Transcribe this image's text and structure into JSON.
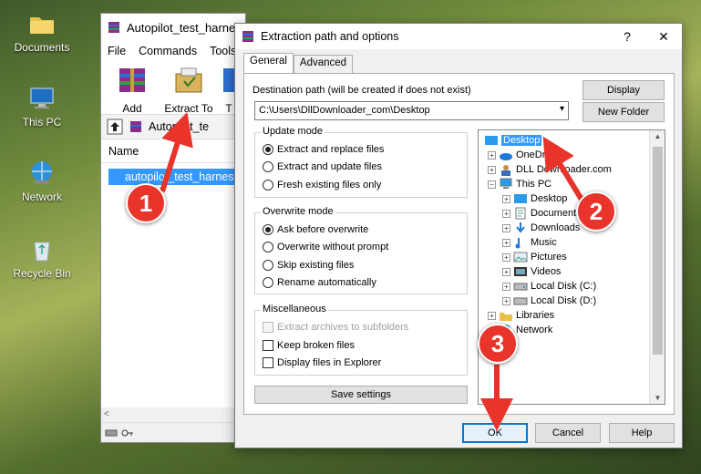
{
  "desktop": {
    "icons": [
      {
        "label": "Documents",
        "icon": "folder-icon"
      },
      {
        "label": "This PC",
        "icon": "computer-icon"
      },
      {
        "label": "Network",
        "icon": "network-icon"
      },
      {
        "label": "Recycle Bin",
        "icon": "recycle-bin-icon"
      }
    ]
  },
  "winrar": {
    "title": "Autopilot_test_harnes",
    "menu": [
      "File",
      "Commands",
      "Tools"
    ],
    "toolbar": {
      "add": "Add",
      "extract_to": "Extract To",
      "third": "T"
    },
    "path": "Autopilot_te",
    "list_header": "Name",
    "file_row": "autopilot_test_harnes"
  },
  "dialog": {
    "title": "Extraction path and options",
    "help": "?",
    "close": "✕",
    "tabs": [
      "General",
      "Advanced"
    ],
    "dest_label": "Destination path (will be created if does not exist)",
    "dest_value": "C:\\Users\\DllDownloader_com\\Desktop",
    "buttons": {
      "display": "Display",
      "new_folder": "New Folder",
      "save_settings": "Save settings",
      "ok": "OK",
      "cancel": "Cancel",
      "help": "Help"
    },
    "update_mode": {
      "title": "Update mode",
      "options": [
        "Extract and replace files",
        "Extract and update files",
        "Fresh existing files only"
      ],
      "selected": 0
    },
    "overwrite_mode": {
      "title": "Overwrite mode",
      "options": [
        "Ask before overwrite",
        "Overwrite without prompt",
        "Skip existing files",
        "Rename automatically"
      ],
      "selected": 0
    },
    "misc": {
      "title": "Miscellaneous",
      "options": [
        "Extract archives to subfolders",
        "Keep broken files",
        "Display files in Explorer"
      ]
    },
    "tree": [
      {
        "label": "Desktop",
        "selected": true
      },
      {
        "label": "OneDrive"
      },
      {
        "label": "DLL Downloader.com"
      },
      {
        "label": "This PC"
      },
      {
        "label": "Desktop"
      },
      {
        "label": "Documents"
      },
      {
        "label": "Downloads"
      },
      {
        "label": "Music"
      },
      {
        "label": "Pictures"
      },
      {
        "label": "Videos"
      },
      {
        "label": "Local Disk (C:)"
      },
      {
        "label": "Local Disk (D:)"
      },
      {
        "label": "Libraries"
      },
      {
        "label": "Network"
      }
    ]
  },
  "annotations": {
    "steps": [
      "1",
      "2",
      "3"
    ],
    "color": "#e8342a"
  }
}
